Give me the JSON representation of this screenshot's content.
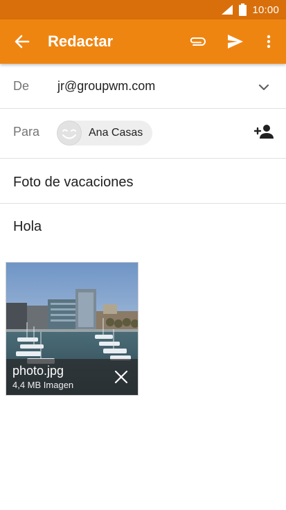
{
  "status_bar": {
    "time": "10:00"
  },
  "app_bar": {
    "title": "Redactar",
    "icons": {
      "back": "arrow-back-icon",
      "attach": "paperclip-icon",
      "send": "send-icon",
      "more": "more-vert-icon"
    }
  },
  "compose": {
    "from_label": "De",
    "from_value": "jr@groupwm.com",
    "to_label": "Para",
    "recipient_name": "Ana Casas",
    "subject": "Foto de vacaciones",
    "body": "Hola"
  },
  "attachment": {
    "file_name": "photo.jpg",
    "file_meta": "4,4 MB Imagen"
  },
  "colors": {
    "accent": "#ef8511",
    "status_bar": "#d96f0a"
  }
}
